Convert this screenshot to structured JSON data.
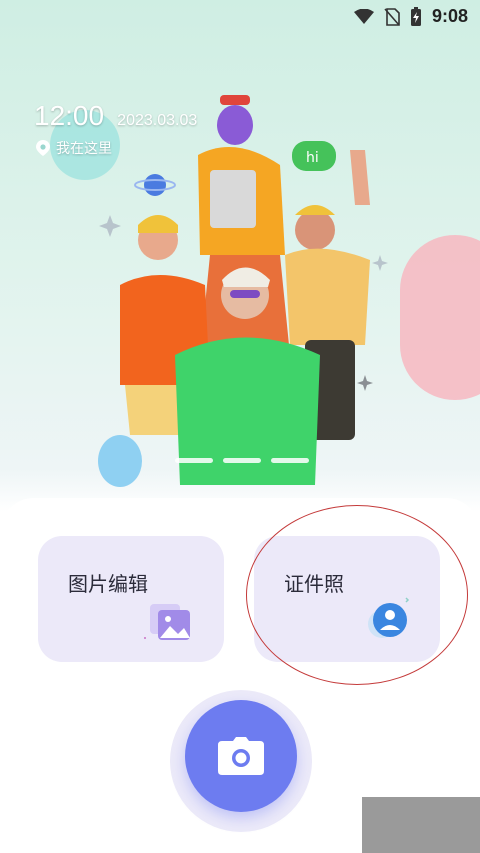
{
  "status_bar": {
    "time": "9:08",
    "icons": [
      "wifi-icon",
      "no-sim-icon",
      "battery-charging-icon"
    ]
  },
  "hero": {
    "time": "12:00",
    "date": "2023.03.03",
    "location": "我在这里",
    "location_icon": "location-pin-icon",
    "speech_bubble": "hi"
  },
  "features": [
    {
      "label": "图片编辑",
      "icon": "image-edit-icon"
    },
    {
      "label": "证件照",
      "icon": "id-photo-icon"
    }
  ],
  "camera": {
    "icon": "camera-icon"
  },
  "colors": {
    "accent": "#6d7cf0",
    "card_bg": "#ece9f9",
    "highlight_ring": "#c43a3a"
  }
}
